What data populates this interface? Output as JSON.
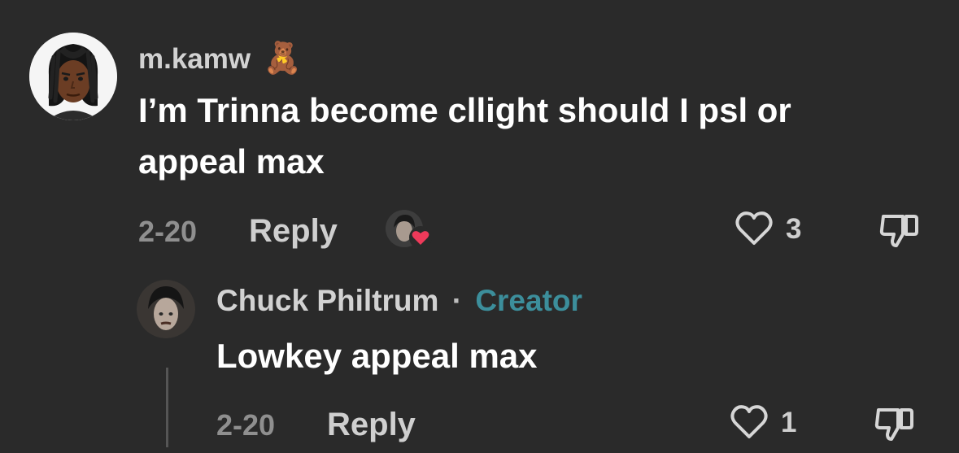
{
  "comment": {
    "username": "m.kamw",
    "username_emoji": "🧸",
    "text_line1": "I’m Trinna become cllight should I psl or",
    "text_line2": "appeal max",
    "date": "2-20",
    "reply_label": "Reply",
    "like_count": "3",
    "creator_liked": true
  },
  "reply": {
    "username": "Chuck Philtrum",
    "separator": "·",
    "creator_label": "Creator",
    "text": "Lowkey appeal max",
    "date": "2-20",
    "reply_label": "Reply",
    "like_count": "1"
  },
  "colors": {
    "background": "#2a2a2a",
    "creator_accent": "#3c8e9b",
    "heart_badge": "#ee3a5a"
  }
}
